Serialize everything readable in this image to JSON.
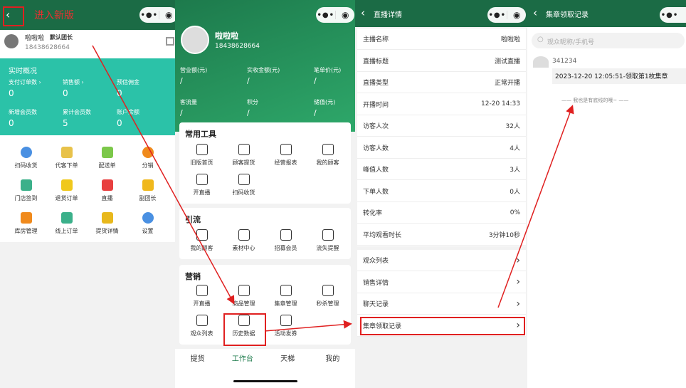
{
  "p1": {
    "annotation": "进入新版",
    "user": {
      "name": "啦啦啦",
      "role": "默认团长",
      "phone": "18438628664"
    },
    "overview": {
      "title": "实时概况",
      "stats": [
        {
          "label": "支付订单数 ›",
          "value": "0"
        },
        {
          "label": "销售额 ›",
          "value": "0"
        },
        {
          "label": "预估佣金",
          "value": "0"
        },
        {
          "label": "新增会员数",
          "value": "0"
        },
        {
          "label": "累计会员数",
          "value": "5"
        },
        {
          "label": "账户余额",
          "value": "0"
        }
      ]
    },
    "grid": [
      {
        "label": "扫码收货",
        "icon": "scan-icon",
        "color": "#4a90e2"
      },
      {
        "label": "代客下单",
        "icon": "order-icon",
        "color": "#e8c24a"
      },
      {
        "label": "配送单",
        "icon": "delivery-icon",
        "color": "#7cc84a"
      },
      {
        "label": "分销",
        "icon": "yen-icon",
        "color": "#f08a1c"
      },
      {
        "label": "门店签到",
        "icon": "tag-icon",
        "color": "#3bb08a"
      },
      {
        "label": "退货订单",
        "icon": "return-icon",
        "color": "#f0c81c"
      },
      {
        "label": "直播",
        "icon": "live-icon",
        "color": "#e84040"
      },
      {
        "label": "副团长",
        "icon": "person-icon",
        "color": "#f0b81c"
      },
      {
        "label": "库房管理",
        "icon": "home-icon",
        "color": "#f08a1c"
      },
      {
        "label": "线上订单",
        "icon": "list-icon",
        "color": "#3bb08a"
      },
      {
        "label": "提货详情",
        "icon": "detail-icon",
        "color": "#e8b81c"
      },
      {
        "label": "设置",
        "icon": "gear-icon",
        "color": "#4a90e2"
      }
    ]
  },
  "p2": {
    "user": {
      "name": "啦啦啦",
      "phone": "18438628664"
    },
    "stats": [
      {
        "label": "营业额(元)",
        "value": "/"
      },
      {
        "label": "实收金额(元)",
        "value": "/"
      },
      {
        "label": "笔单价(元)",
        "value": "/"
      },
      {
        "label": "客流量",
        "value": "/"
      },
      {
        "label": "积分",
        "value": "/"
      },
      {
        "label": "储值(元)",
        "value": "/"
      }
    ],
    "sections": [
      {
        "title": "常用工具",
        "items": [
          {
            "label": "旧版首页",
            "icon": "exit-icon"
          },
          {
            "label": "顾客提货",
            "icon": "pickup-icon"
          },
          {
            "label": "经营报表",
            "icon": "report-icon"
          },
          {
            "label": "我的顾客",
            "icon": "customers-icon"
          },
          {
            "label": "开直播",
            "icon": "tv-icon"
          },
          {
            "label": "扫码收货",
            "icon": "scan-icon"
          }
        ]
      },
      {
        "title": "引流",
        "items": [
          {
            "label": "我的顾客",
            "icon": "customers-icon"
          },
          {
            "label": "素材中心",
            "icon": "play-icon"
          },
          {
            "label": "招募会员",
            "icon": "diamond-icon"
          },
          {
            "label": "流失提醒",
            "icon": "bell-icon"
          }
        ]
      },
      {
        "title": "营销",
        "items": [
          {
            "label": "开直播",
            "icon": "tv-icon"
          },
          {
            "label": "商品管理",
            "icon": "bag-icon"
          },
          {
            "label": "集章管理",
            "icon": "badge-icon"
          },
          {
            "label": "秒杀管理",
            "icon": "flash-icon"
          },
          {
            "label": "观众列表",
            "icon": "audience-icon"
          },
          {
            "label": "历史数据",
            "icon": "history-icon"
          },
          {
            "label": "活动发券",
            "icon": "ticket-icon"
          }
        ]
      }
    ],
    "tabs": [
      "提货",
      "工作台",
      "天梯",
      "我的"
    ]
  },
  "p3": {
    "title": "直播详情",
    "rows": [
      {
        "k": "主播名称",
        "v": "啦啦啦"
      },
      {
        "k": "直播标题",
        "v": "测试直播"
      },
      {
        "k": "直播类型",
        "v": "正常开播"
      },
      {
        "k": "开播时间",
        "v": "12-20 14:33"
      },
      {
        "k": "访客人次",
        "v": "32人"
      },
      {
        "k": "访客人数",
        "v": "4人"
      },
      {
        "k": "峰值人数",
        "v": "3人"
      },
      {
        "k": "下单人数",
        "v": "0人"
      },
      {
        "k": "转化率",
        "v": "0%"
      },
      {
        "k": "平均观看时长",
        "v": "3分钟10秒"
      }
    ],
    "links": [
      "观众列表",
      "销售详情",
      "聊天记录",
      "集章领取记录"
    ]
  },
  "p4": {
    "title": "集章领取记录",
    "search_placeholder": "观众昵称/手机号",
    "record": {
      "id": "341234",
      "text": "2023-12-20 12:05:51-领取第1枚集章"
    },
    "footer": "—— 我也是有底线的哦~ ——"
  }
}
